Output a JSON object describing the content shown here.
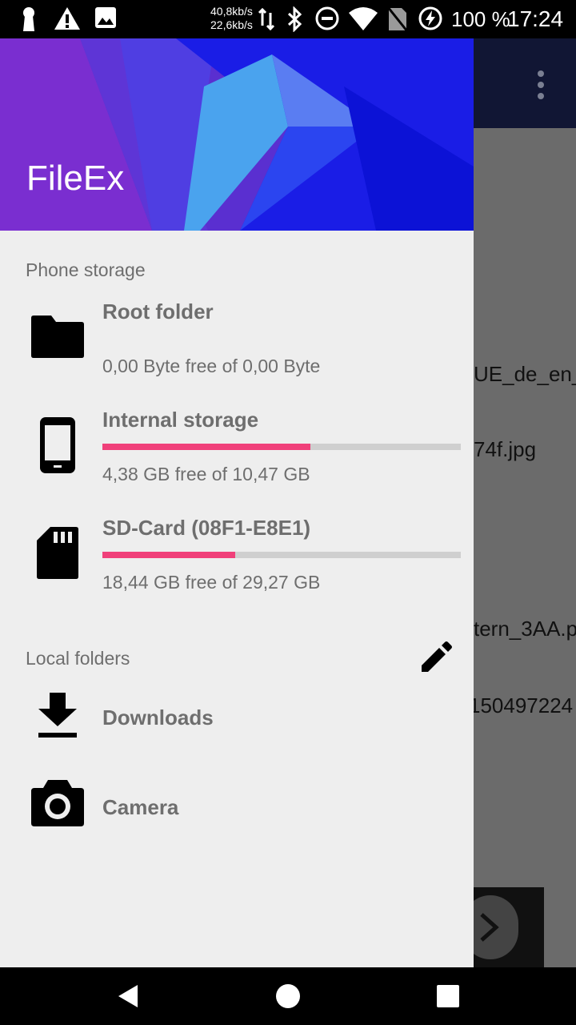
{
  "status_bar": {
    "net_up": "40,8kb/s",
    "net_down": "22,6kb/s",
    "battery": "100 %",
    "time": "17:24",
    "icons": [
      "keyhole-icon",
      "warning-icon",
      "image-icon",
      "data-transfer-icon",
      "bluetooth-icon",
      "do-not-disturb-icon",
      "wifi-icon",
      "no-sim-icon",
      "battery-charging-icon"
    ]
  },
  "background_app": {
    "files": [
      "UE_de_en_",
      "74f.jpg",
      "tern_3AA.p",
      "150497224"
    ]
  },
  "drawer": {
    "app_title": "FileEx",
    "phone_storage": {
      "title": "Phone storage",
      "items": [
        {
          "label": "Root folder",
          "detail": "0,00 Byte free of 0,00 Byte",
          "icon": "folder-icon"
        },
        {
          "label": "Internal storage",
          "detail": "4,38 GB free of 10,47 GB",
          "icon": "phone-icon",
          "used_fraction": 0.58
        },
        {
          "label": "SD-Card (08F1-E8E1)",
          "detail": "18,44 GB free of 29,27 GB",
          "icon": "sd-card-icon",
          "used_fraction": 0.37
        }
      ]
    },
    "local_folders": {
      "title": "Local folders",
      "edit_icon": "pencil-icon",
      "items": [
        {
          "label": "Downloads",
          "icon": "download-icon"
        },
        {
          "label": "Camera",
          "icon": "camera-icon"
        }
      ]
    }
  },
  "nav_bar": {
    "icons": [
      "back-icon",
      "home-icon",
      "recents-icon"
    ]
  },
  "colors": {
    "accent": "#f0407a",
    "drawer_bg": "#eeeeee",
    "text_secondary": "#6e6e6e"
  }
}
